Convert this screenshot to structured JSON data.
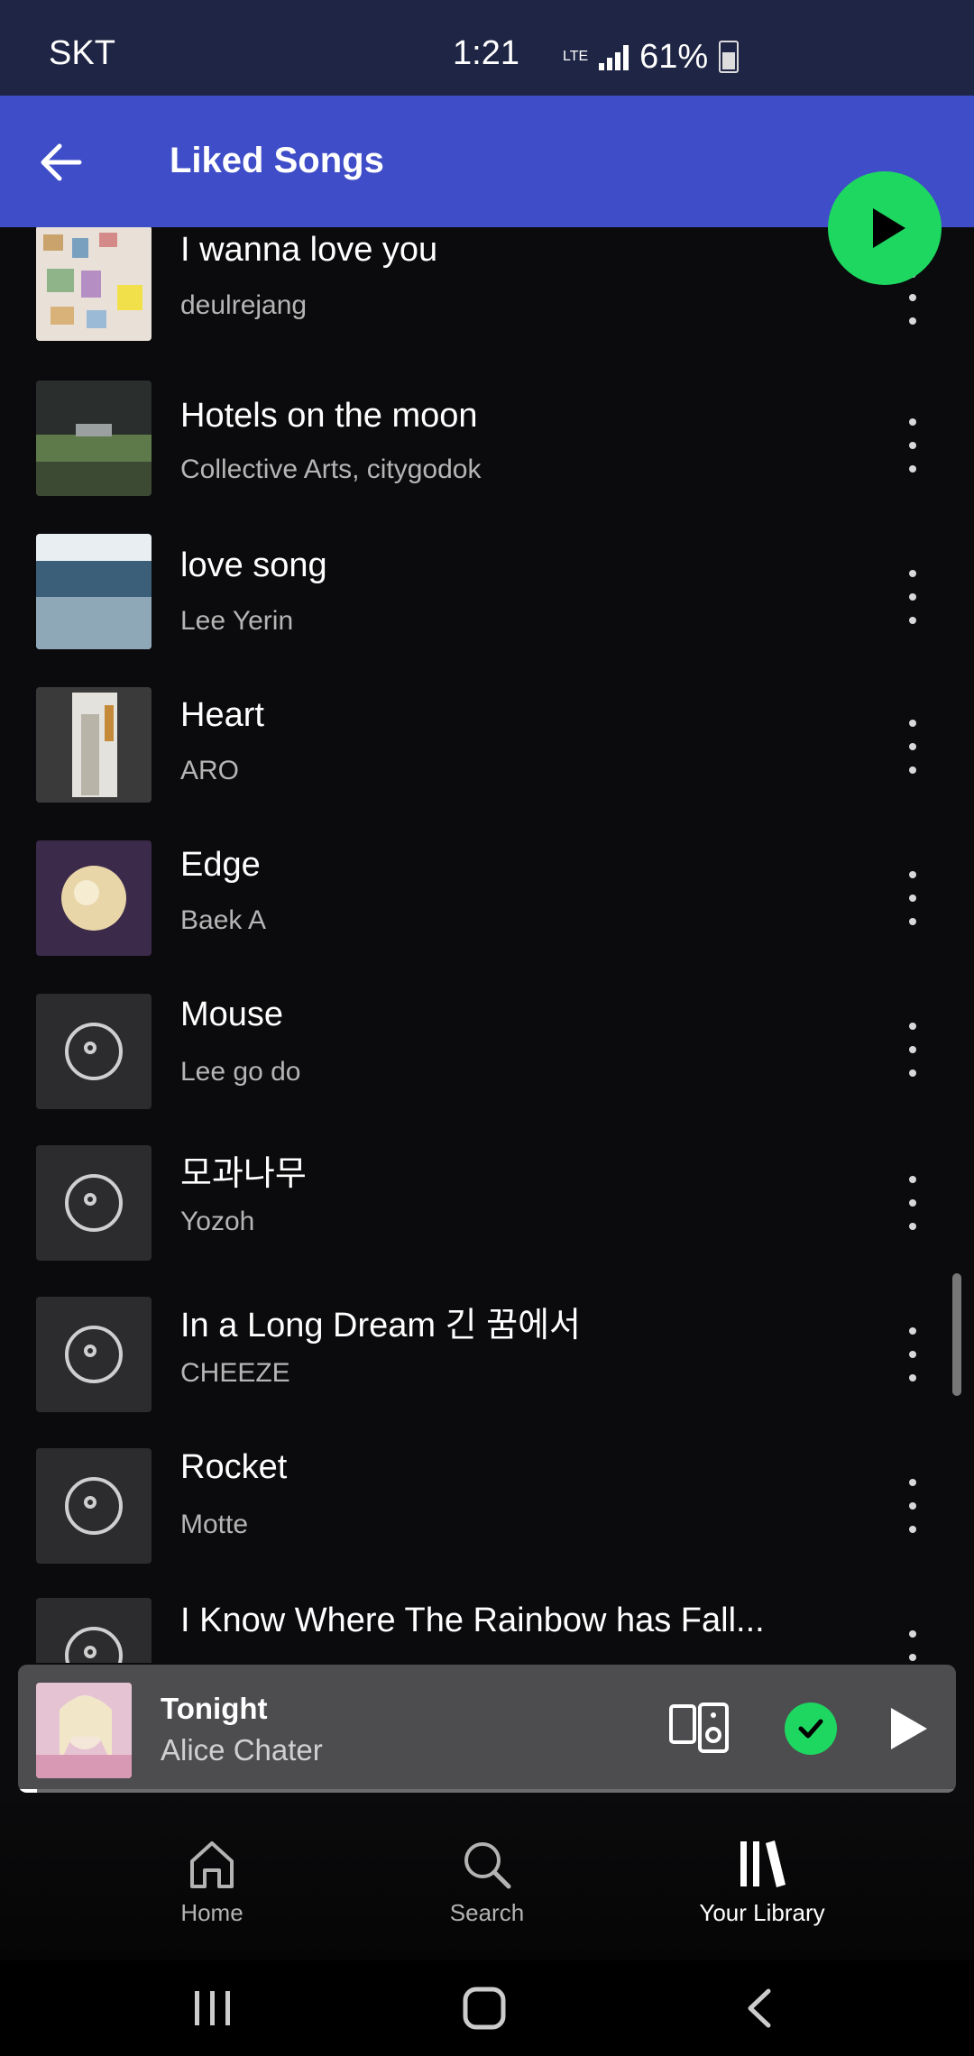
{
  "status_bar": {
    "carrier": "SKT",
    "time": "1:21",
    "network": "LTE",
    "battery": "61%"
  },
  "header": {
    "title": "Liked Songs"
  },
  "songs": [
    {
      "title": "I wanna love you",
      "artist": "deulrejang"
    },
    {
      "title": "Hotels on the moon",
      "artist": "Collective Arts, citygodok"
    },
    {
      "title": "love song",
      "artist": "Lee Yerin"
    },
    {
      "title": "Heart",
      "artist": "ARO"
    },
    {
      "title": "Edge",
      "artist": "Baek A"
    },
    {
      "title": "Mouse",
      "artist": "Lee go do"
    },
    {
      "title": "모과나무",
      "artist": "Yozoh"
    },
    {
      "title": "In a Long Dream 긴 꿈에서",
      "artist": "CHEEZE"
    },
    {
      "title": "Rocket",
      "artist": "Motte"
    },
    {
      "title": "I Know Where The Rainbow has Fall...",
      "artist": ""
    }
  ],
  "now_playing": {
    "title": "Tonight",
    "artist": "Alice Chater",
    "progress": 0.02
  },
  "bottom_nav": {
    "home": "Home",
    "search": "Search",
    "library": "Your Library"
  },
  "colors": {
    "accent": "#1ed760",
    "header_bg": "#3f4dc8",
    "status_bg": "#1f2544"
  }
}
